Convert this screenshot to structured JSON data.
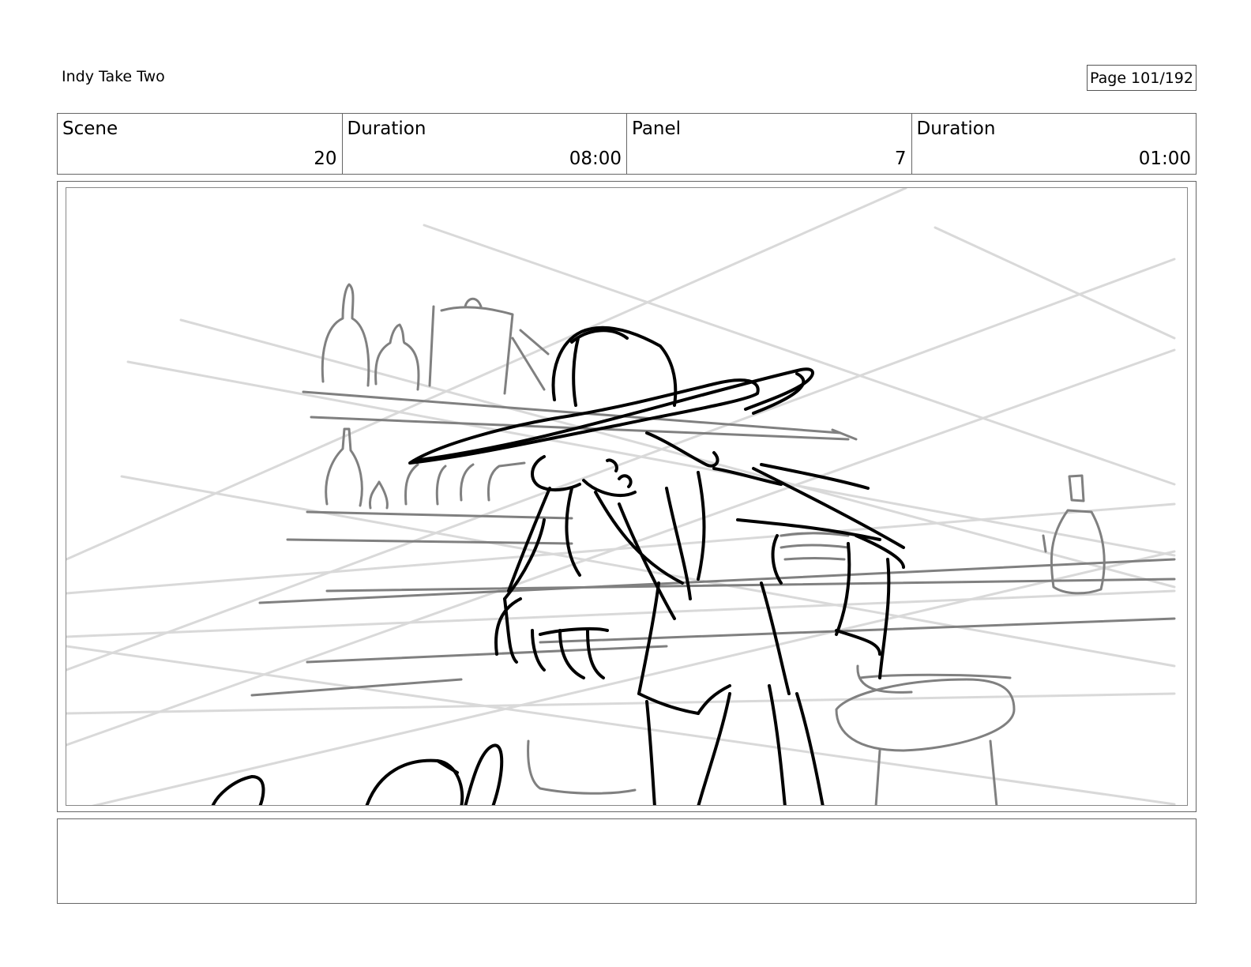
{
  "header": {
    "project_title": "Indy Take Two",
    "page_indicator": "Page 101/192"
  },
  "info": [
    {
      "label": "Scene",
      "value": "20"
    },
    {
      "label": "Duration",
      "value": "08:00"
    },
    {
      "label": "Panel",
      "value": "7"
    },
    {
      "label": "Duration",
      "value": "01:00"
    }
  ],
  "notes": {
    "text": ""
  }
}
